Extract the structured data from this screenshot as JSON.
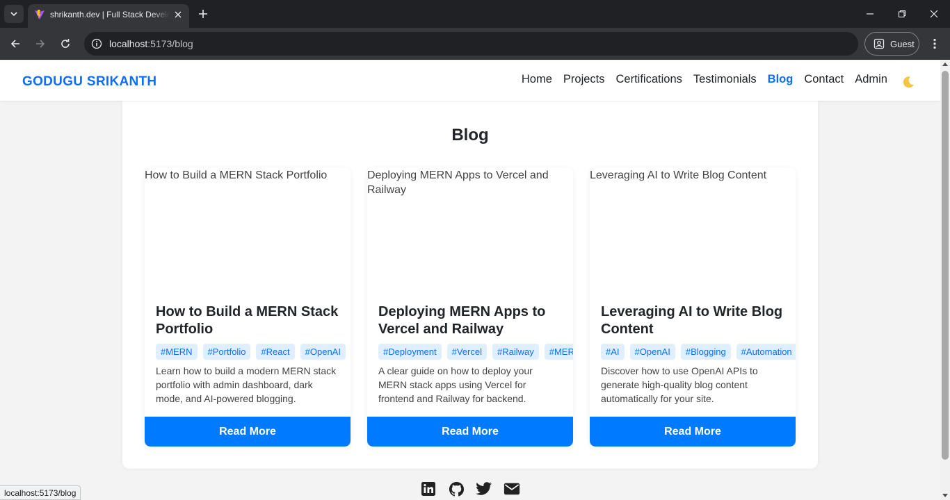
{
  "browser": {
    "tab_title": "shrikanth.dev | Full Stack Developer",
    "url_host": "localhost",
    "url_path": ":5173/blog",
    "profile_label": "Guest",
    "status_url": "localhost:5173/blog"
  },
  "site": {
    "brand": "GODUGU SRIKANTH",
    "nav": [
      "Home",
      "Projects",
      "Certifications",
      "Testimonials",
      "Blog",
      "Contact",
      "Admin"
    ],
    "active_nav": "Blog",
    "accent_color": "#0d6efd"
  },
  "blog": {
    "heading": "Blog",
    "read_more_label": "Read More",
    "posts": [
      {
        "image_alt": "How to Build a MERN Stack Portfolio",
        "title": "How to Build a MERN Stack Portfolio",
        "tags": [
          "#MERN",
          "#Portfolio",
          "#React",
          "#OpenAI"
        ],
        "excerpt": "Learn how to build a modern MERN stack portfolio with admin dashboard, dark mode, and AI-powered blogging."
      },
      {
        "image_alt": "Deploying MERN Apps to Vercel and Railway",
        "title": "Deploying MERN Apps to Vercel and Railway",
        "tags": [
          "#Deployment",
          "#Vercel",
          "#Railway",
          "#MERN"
        ],
        "excerpt": "A clear guide on how to deploy your MERN stack apps using Vercel for frontend and Railway for backend."
      },
      {
        "image_alt": "Leveraging AI to Write Blog Content",
        "title": "Leveraging AI to Write Blog Content",
        "tags": [
          "#AI",
          "#OpenAI",
          "#Blogging",
          "#Automation"
        ],
        "excerpt": "Discover how to use OpenAI APIs to generate high-quality blog content automatically for your site."
      }
    ]
  },
  "footer": {
    "social_icons": [
      "linkedin-icon",
      "github-icon",
      "twitter-icon",
      "email-icon"
    ]
  }
}
